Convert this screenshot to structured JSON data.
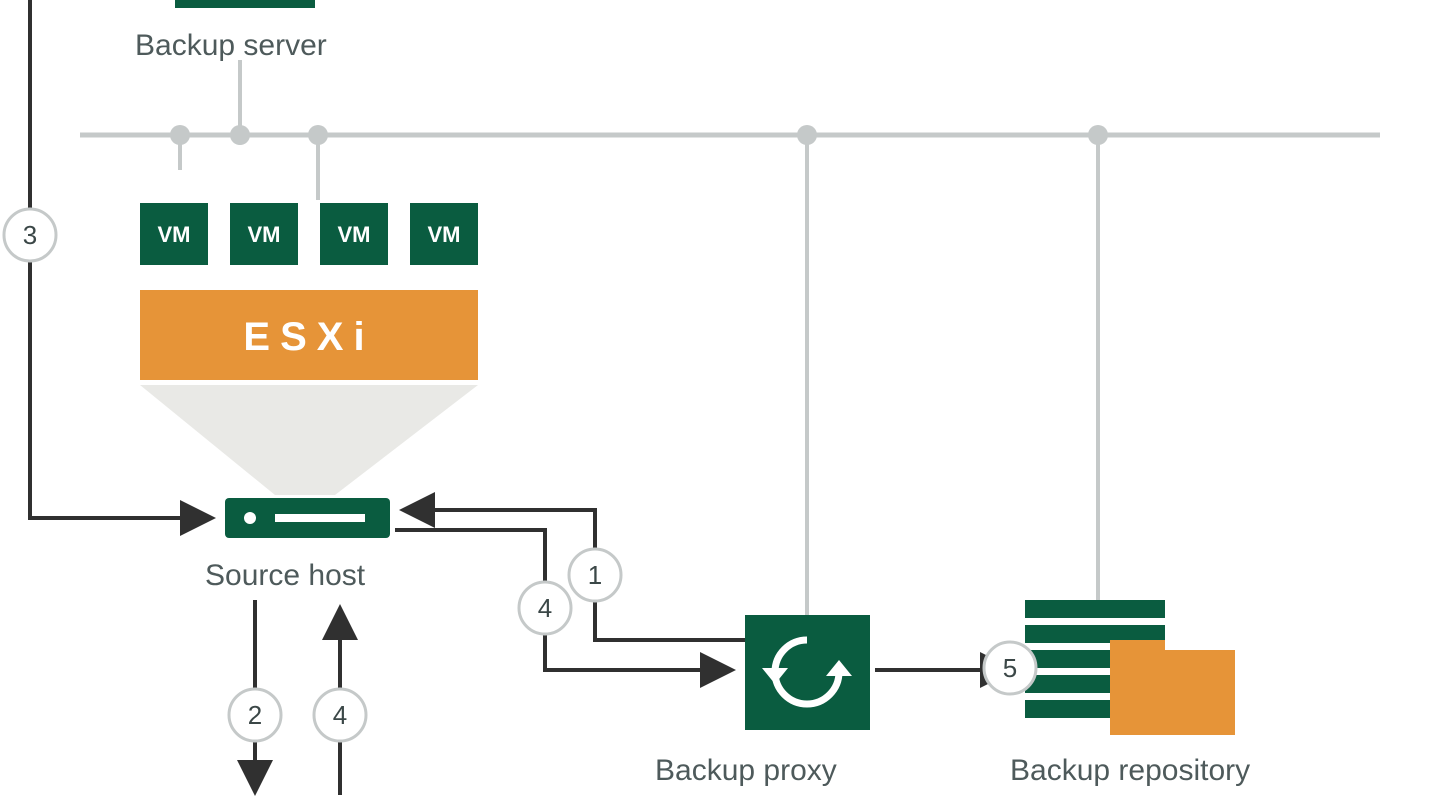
{
  "labels": {
    "backup_server": "Backup server",
    "source_host": "Source host",
    "backup_proxy": "Backup proxy",
    "backup_repository": "Backup repository",
    "esxi": "ESXi",
    "vm": "VM"
  },
  "steps": {
    "s1": "1",
    "s2": "2",
    "s3": "3",
    "s4a": "4",
    "s4b": "4",
    "s5": "5"
  },
  "colors": {
    "green": "#0a5c40",
    "orange": "#e69438",
    "grey_line": "#c5c9c9",
    "grey_text": "#4e5a5b",
    "arrow": "#303030"
  },
  "nodes": [
    {
      "id": "backup-server",
      "label": "Backup server"
    },
    {
      "id": "source-host",
      "label": "Source host",
      "contains": [
        "VM",
        "VM",
        "VM",
        "VM",
        "ESXi"
      ]
    },
    {
      "id": "backup-proxy",
      "label": "Backup proxy"
    },
    {
      "id": "backup-repository",
      "label": "Backup repository"
    }
  ],
  "edges": [
    {
      "from": "backup-proxy",
      "to": "source-host",
      "step": "1"
    },
    {
      "from": "source-host",
      "to": "below",
      "step": "2"
    },
    {
      "from": "backup-server",
      "to": "source-host",
      "step": "3"
    },
    {
      "from": "below",
      "to": "source-host",
      "step": "4"
    },
    {
      "from": "source-host",
      "to": "backup-proxy",
      "step": "4"
    },
    {
      "from": "backup-proxy",
      "to": "backup-repository",
      "step": "5"
    }
  ]
}
